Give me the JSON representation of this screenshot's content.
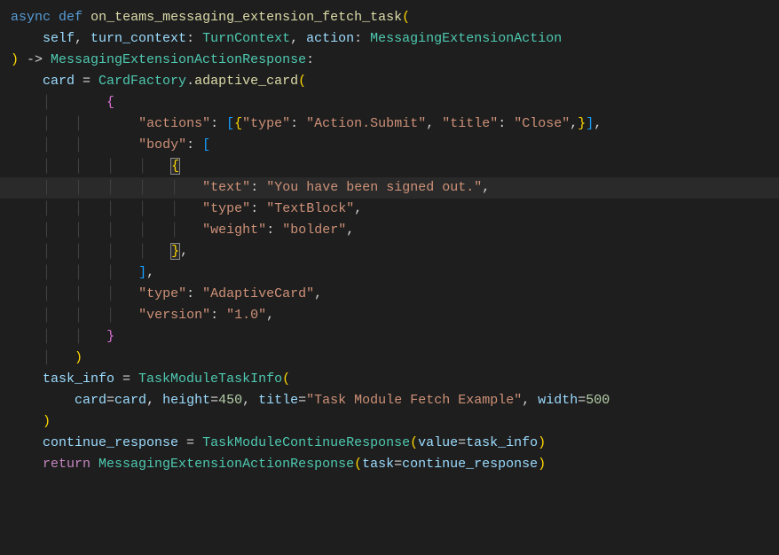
{
  "code": {
    "line1": {
      "async": "async",
      "def": "def",
      "funcName": "on_teams_messaging_extension_fetch_task",
      "openParen": "("
    },
    "line2": {
      "self": "self",
      "comma1": ", ",
      "param1": "turn_context",
      "colon1": ": ",
      "type1": "TurnContext",
      "comma2": ", ",
      "param2": "action",
      "colon2": ": ",
      "type2": "MessagingExtensionAction"
    },
    "line3": {
      "closeParen": ")",
      "arrow": " -> ",
      "returnType": "MessagingExtensionActionResponse",
      "colon": ":"
    },
    "line4": {
      "var": "card",
      "equals": " = ",
      "class": "CardFactory",
      "dot": ".",
      "method": "adaptive_card",
      "openParen": "("
    },
    "line5": {
      "openBrace": "{"
    },
    "line6": {
      "key1": "\"actions\"",
      "colon1": ": ",
      "openBracket": "[",
      "openBrace": "{",
      "key2": "\"type\"",
      "colon2": ": ",
      "val2": "\"Action.Submit\"",
      "comma2": ", ",
      "key3": "\"title\"",
      "colon3": ": ",
      "val3": "\"Close\"",
      "comma3": ",",
      "closeBrace": "}",
      "closeBracket": "]",
      "comma4": ","
    },
    "line7": {
      "key": "\"body\"",
      "colon": ": ",
      "openBracket": "["
    },
    "line8": {
      "openBrace": "{"
    },
    "line9": {
      "key": "\"text\"",
      "colon": ": ",
      "val": "\"You have been signed out.\"",
      "comma": ","
    },
    "line10": {
      "key": "\"type\"",
      "colon": ": ",
      "val": "\"TextBlock\"",
      "comma": ","
    },
    "line11": {
      "key": "\"weight\"",
      "colon": ": ",
      "val": "\"bolder\"",
      "comma": ","
    },
    "line12": {
      "closeBrace": "}",
      "comma": ","
    },
    "line13": {
      "closeBracket": "]",
      "comma": ","
    },
    "line14": {
      "key": "\"type\"",
      "colon": ": ",
      "val": "\"AdaptiveCard\"",
      "comma": ","
    },
    "line15": {
      "key": "\"version\"",
      "colon": ": ",
      "val": "\"1.0\"",
      "comma": ","
    },
    "line16": {
      "closeBrace": "}"
    },
    "line17": {
      "closeParen": ")"
    },
    "line18": {
      "var": "task_info",
      "equals": " = ",
      "class": "TaskModuleTaskInfo",
      "openParen": "("
    },
    "line19": {
      "param1": "card",
      "eq1": "=",
      "val1": "card",
      "comma1": ", ",
      "param2": "height",
      "eq2": "=",
      "val2": "450",
      "comma2": ", ",
      "param3": "title",
      "eq3": "=",
      "val3": "\"Task Module Fetch Example\"",
      "comma3": ", ",
      "param4": "width",
      "eq4": "=",
      "val4": "500"
    },
    "line20": {
      "closeParen": ")"
    },
    "line21": {
      "var": "continue_response",
      "equals": " = ",
      "class": "TaskModuleContinueResponse",
      "openParen": "(",
      "param": "value",
      "eq": "=",
      "val": "task_info",
      "closeParen": ")"
    },
    "line22": {
      "return": "return",
      "space": " ",
      "class": "MessagingExtensionActionResponse",
      "openParen": "(",
      "param": "task",
      "eq": "=",
      "val": "continue_response",
      "closeParen": ")"
    }
  }
}
